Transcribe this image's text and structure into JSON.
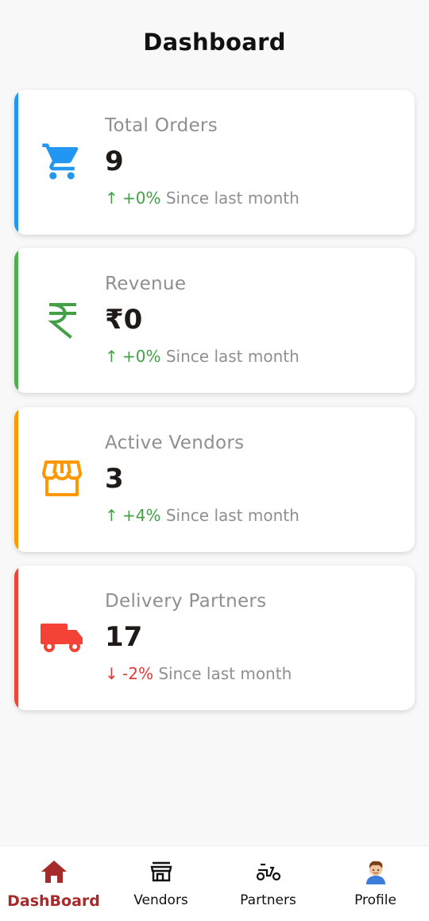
{
  "header": {
    "title": "Dashboard"
  },
  "cards": [
    {
      "label": "Total Orders",
      "value": "9",
      "trend_arrow": "↑",
      "trend_value": "+0%",
      "trend_text": "Since last month",
      "trend_dir": "up",
      "icon": "shopping-cart-icon",
      "accent": "#2196f3"
    },
    {
      "label": "Revenue",
      "value": "₹0",
      "trend_arrow": "↑",
      "trend_value": "+0%",
      "trend_text": "Since last month",
      "trend_dir": "up",
      "icon": "rupee-icon",
      "accent": "#4caf50"
    },
    {
      "label": "Active Vendors",
      "value": "3",
      "trend_arrow": "↑",
      "trend_value": "+4%",
      "trend_text": "Since last month",
      "trend_dir": "up",
      "icon": "storefront-icon",
      "accent": "#ff9800"
    },
    {
      "label": "Delivery Partners",
      "value": "17",
      "trend_arrow": "↓",
      "trend_value": "-2%",
      "trend_text": "Since last month",
      "trend_dir": "down",
      "icon": "delivery-truck-icon",
      "accent": "#f44336"
    }
  ],
  "colors": {
    "up": "#43a047",
    "down": "#e53935",
    "active_nav": "#a52a2a"
  },
  "bottom_nav": [
    {
      "label": "DashBoard",
      "icon": "home-icon",
      "active": true
    },
    {
      "label": "Vendors",
      "icon": "store-icon",
      "active": false
    },
    {
      "label": "Partners",
      "icon": "scooter-icon",
      "active": false
    },
    {
      "label": "Profile",
      "icon": "avatar-icon",
      "active": false
    }
  ]
}
